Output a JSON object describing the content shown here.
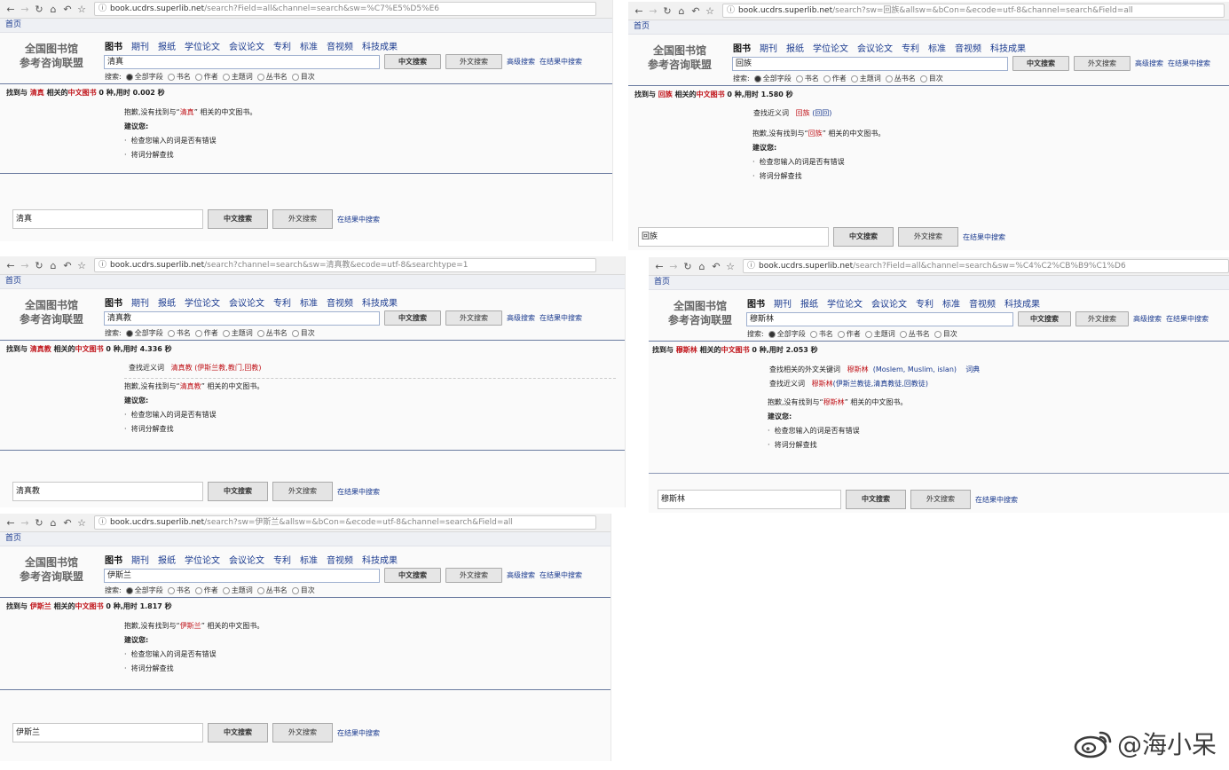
{
  "common": {
    "home": "首页",
    "logo_line1": "全国图书馆",
    "logo_line2": "参考咨询联盟",
    "channels": [
      "图书",
      "期刊",
      "报纸",
      "学位论文",
      "会议论文",
      "专利",
      "标准",
      "音视频",
      "科技成果"
    ],
    "search_btn": "中文搜索",
    "foreign_btn": "外文搜索",
    "advanced": "高级搜索",
    "in_results": "在结果中搜索",
    "radio_prefix": "搜索:",
    "radios": [
      "全部字段",
      "书名",
      "作者",
      "主题词",
      "丛书名",
      "目次"
    ],
    "result_prefix": "找到与",
    "result_middle": "相关的",
    "result_cat": "中文图书",
    "sorry_prefix": "抱歉,没有找到与“",
    "sorry_suffix": "” 相关的中文图书。",
    "suggest_label": "建议您:",
    "tip1": "检查您输入的词是否有错误",
    "tip2": "将词分解查找",
    "near_label": "查找近义词",
    "foreign_label": "查找相关的外文关键词"
  },
  "panels": [
    {
      "url_host": "book.ucdrs.superlib.net",
      "url_path": "/search?Field=all&channel=search&sw=%C7%E5%D5%E6",
      "query": "清真",
      "result_suffix": "0 种,用时 0.002 秒"
    },
    {
      "url_host": "book.ucdrs.superlib.net",
      "url_path": "/search?sw=回族&allsw=&bCon=&ecode=utf-8&channel=search&Field=all",
      "query": "回族",
      "result_suffix": "0 种,用时 1.580 秒",
      "near_kw": "回族",
      "near_alt": "(回回)"
    },
    {
      "url_host": "book.ucdrs.superlib.net",
      "url_path": "/search?channel=search&sw=清真教&ecode=utf-8&searchtype=1",
      "query": "清真教",
      "result_suffix": "0 种,用时 4.336 秒",
      "near_kw": "清真教",
      "near_alt": "(伊斯兰教,教门,回教)"
    },
    {
      "url_host": "book.ucdrs.superlib.net",
      "url_path": "/search?Field=all&channel=search&sw=%C4%C2%CB%B9%C1%D6",
      "query": "穆斯林",
      "result_suffix": "0 种,用时 2.053 秒",
      "foreign_kw": "穆斯林",
      "foreign_alt": "(Moslem, Muslim, islan)",
      "dict": "词典",
      "near_kw": "穆斯林",
      "near_alt": "(伊斯兰教徒,清真教徒,回教徒)"
    },
    {
      "url_host": "book.ucdrs.superlib.net",
      "url_path": "/search?sw=伊斯兰&allsw=&bCon=&ecode=utf-8&channel=search&Field=all",
      "query": "伊斯兰",
      "result_suffix": "0 种,用时 1.817 秒"
    }
  ],
  "watermark": "@海小呆",
  "icons": [
    "back-icon",
    "forward-icon",
    "reload-icon",
    "home-icon",
    "undo-icon",
    "star-icon",
    "info-icon",
    "weibo-icon"
  ]
}
